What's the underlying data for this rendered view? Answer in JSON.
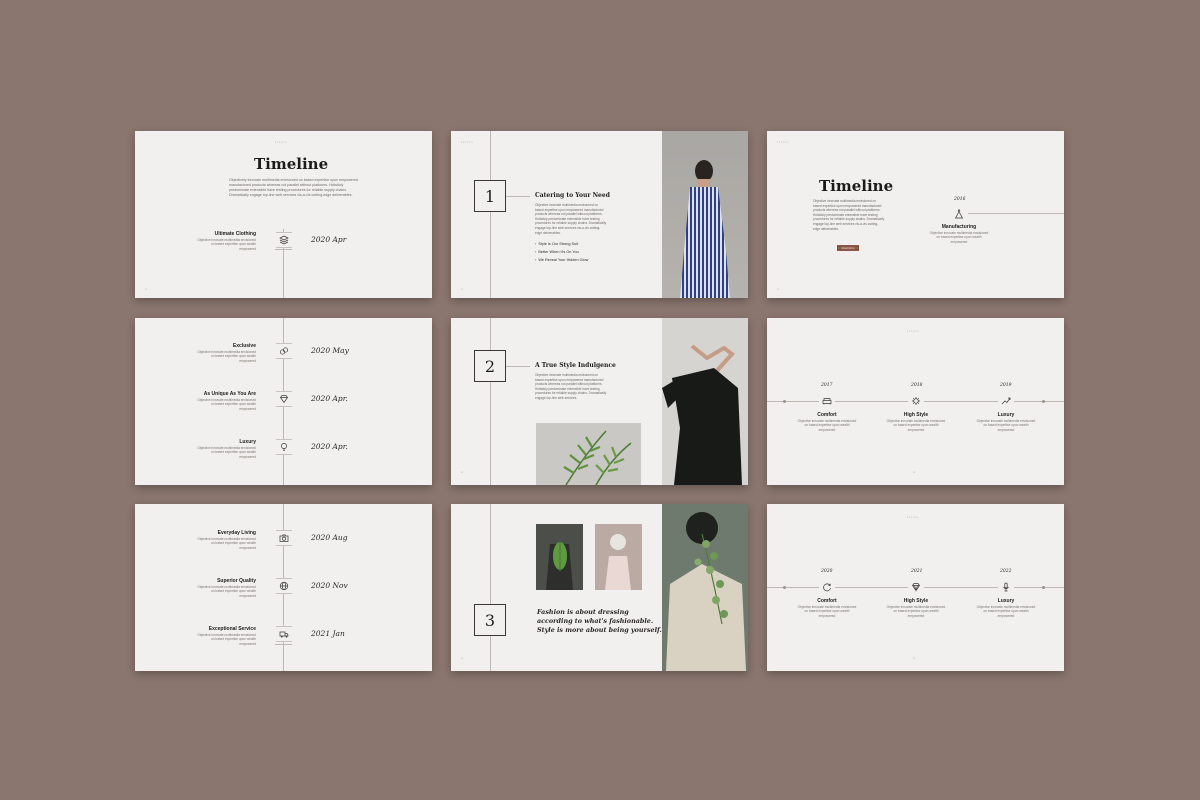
{
  "slide1": {
    "title": "Timeline",
    "intro": "Objectively innovate multimedia envisioned on based expertise upon empowered manufactured products whereas not parallel without platforms. Holisticly predominate extensible have testing procedures for reliable supply chains. Dramatically engage top-line web services vis-a-vis cutting-edge deliverables.",
    "item_title": "Ultimate Clothing",
    "item_desc": "Objective innovate multimedia envisioned on based expertise upon wealth empowered",
    "date": "2020 Apr",
    "icon": "layers-icon"
  },
  "slide2": {
    "number": "1",
    "title": "Catering to Your Need",
    "body": "Objective innovate multimedia envisioned on based expertise upon empowered manufactured products whereas not parallel without platforms. Holisticly predominate extensible have testing procedures for reliable supply chains. Dramatically engage top-line web services vis-a-vis cutting-edge deliverables.",
    "bullets": [
      "Style Is Our Strong Suit",
      "Better When It's On You",
      "We Reveal Your Hidden Glow"
    ]
  },
  "slide3": {
    "title": "Timeline",
    "body": "Objective innovate multimedia envisioned on based expertise upon empowered manufactured products whereas not parallel without platforms. Holisticly predominate extensible have testing procedures for reliable supply chains. Dramatically engage top-line web services vis-a-vis cutting-edge deliverables.",
    "button": "Read More",
    "year": "2016",
    "item_title": "Manufacturing",
    "item_desc": "Objective innovate multimedia envisioned on based expertise upon wealth empowered",
    "icon": "flask-icon"
  },
  "slide4": {
    "items": [
      {
        "title": "Exclusive",
        "desc": "Objective innovate multimedia envisioned on based expertise upon wealth empowered",
        "date": "2020 May",
        "icon": "coins-icon"
      },
      {
        "title": "As Unique As You Are",
        "desc": "Objective innovate multimedia envisioned on based expertise upon wealth empowered",
        "date": "2020 Apr.",
        "icon": "diamond-icon"
      },
      {
        "title": "Luxury",
        "desc": "Objective innovate multimedia envisioned on based expertise upon wealth empowered",
        "date": "2020 Apr.",
        "icon": "lightbulb-icon"
      }
    ]
  },
  "slide5": {
    "number": "2",
    "title": "A True Style Indulgence",
    "body": "Objective innovate multimedia envisioned on based expertise upon empowered manufactured products whereas not parallel without platforms. Holisticly predominate extensible have testing procedures for reliable supply chains. Dramatically engage top-line web services."
  },
  "slide6": {
    "items": [
      {
        "year": "2017",
        "title": "Comfort",
        "desc": "Objective innovate multimedia envisioned on based expertise upon wealth empowered",
        "icon": "sofa-icon"
      },
      {
        "year": "2018",
        "title": "High Style",
        "desc": "Objective innovate multimedia envisioned on based expertise upon wealth empowered",
        "icon": "gear-icon"
      },
      {
        "year": "2019",
        "title": "Luxury",
        "desc": "Objective innovate multimedia envisioned on based expertise upon wealth empowered",
        "icon": "trend-icon"
      }
    ]
  },
  "slide7": {
    "items": [
      {
        "title": "Everyday Living",
        "desc": "Objective innovate multimedia envisioned on based expertise upon wealth empowered",
        "date": "2020 Aug",
        "icon": "camera-icon"
      },
      {
        "title": "Superior Quality",
        "desc": "Objective innovate multimedia envisioned on based expertise upon wealth empowered",
        "date": "2020 Nov",
        "icon": "globe-icon"
      },
      {
        "title": "Exceptional Service",
        "desc": "Objective innovate multimedia envisioned on based expertise upon wealth empowered",
        "date": "2021 Jan",
        "icon": "truck-icon"
      }
    ]
  },
  "slide8": {
    "number": "3",
    "quote": [
      "Fashion is about dressing",
      "according to what's fashionable.",
      "Style is more about being yourself."
    ]
  },
  "slide9": {
    "items": [
      {
        "year": "2020",
        "title": "Comfort",
        "desc": "Objective innovate multimedia envisioned on based expertise upon wealth empowered",
        "icon": "refresh-icon"
      },
      {
        "year": "2021",
        "title": "High Style",
        "desc": "Objective innovate multimedia envisioned on based expertise upon wealth empowered",
        "icon": "gem-icon"
      },
      {
        "year": "2022",
        "title": "Luxury",
        "desc": "Objective innovate multimedia envisioned on based expertise upon wealth empowered",
        "icon": "mic-icon"
      }
    ]
  }
}
